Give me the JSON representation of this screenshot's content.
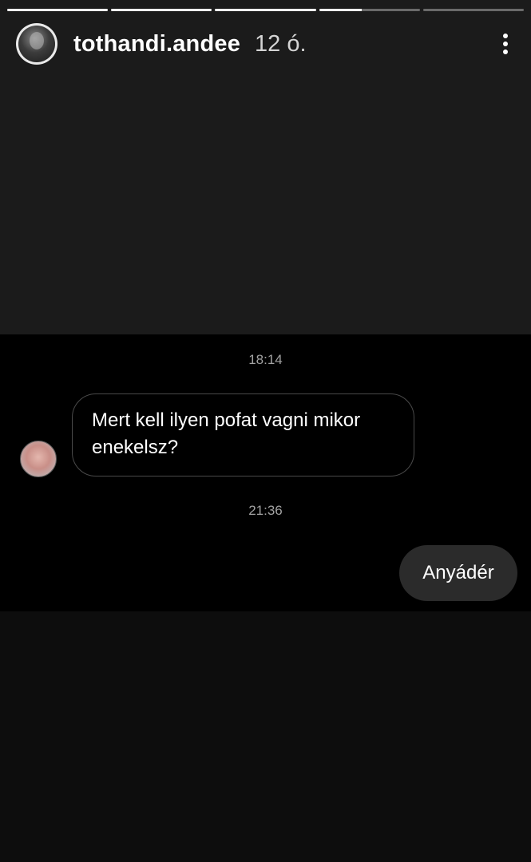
{
  "story": {
    "progress": [
      1,
      1,
      1,
      0.42,
      0
    ],
    "username": "tothandi.andee",
    "time_ago": "12 ó."
  },
  "chat": {
    "timestamp_1": "18:14",
    "incoming_message": "Mert kell ilyen pofat vagni mikor enekelsz?",
    "timestamp_2": "21:36",
    "outgoing_message": "Anyádér"
  },
  "icons": {
    "more": "more-vertical-icon"
  },
  "colors": {
    "background": "#1b1b1b",
    "chat_background": "#000000",
    "outgoing_bubble": "#2b2b2b",
    "text": "#ffffff",
    "timestamp": "#a2a2a2"
  }
}
